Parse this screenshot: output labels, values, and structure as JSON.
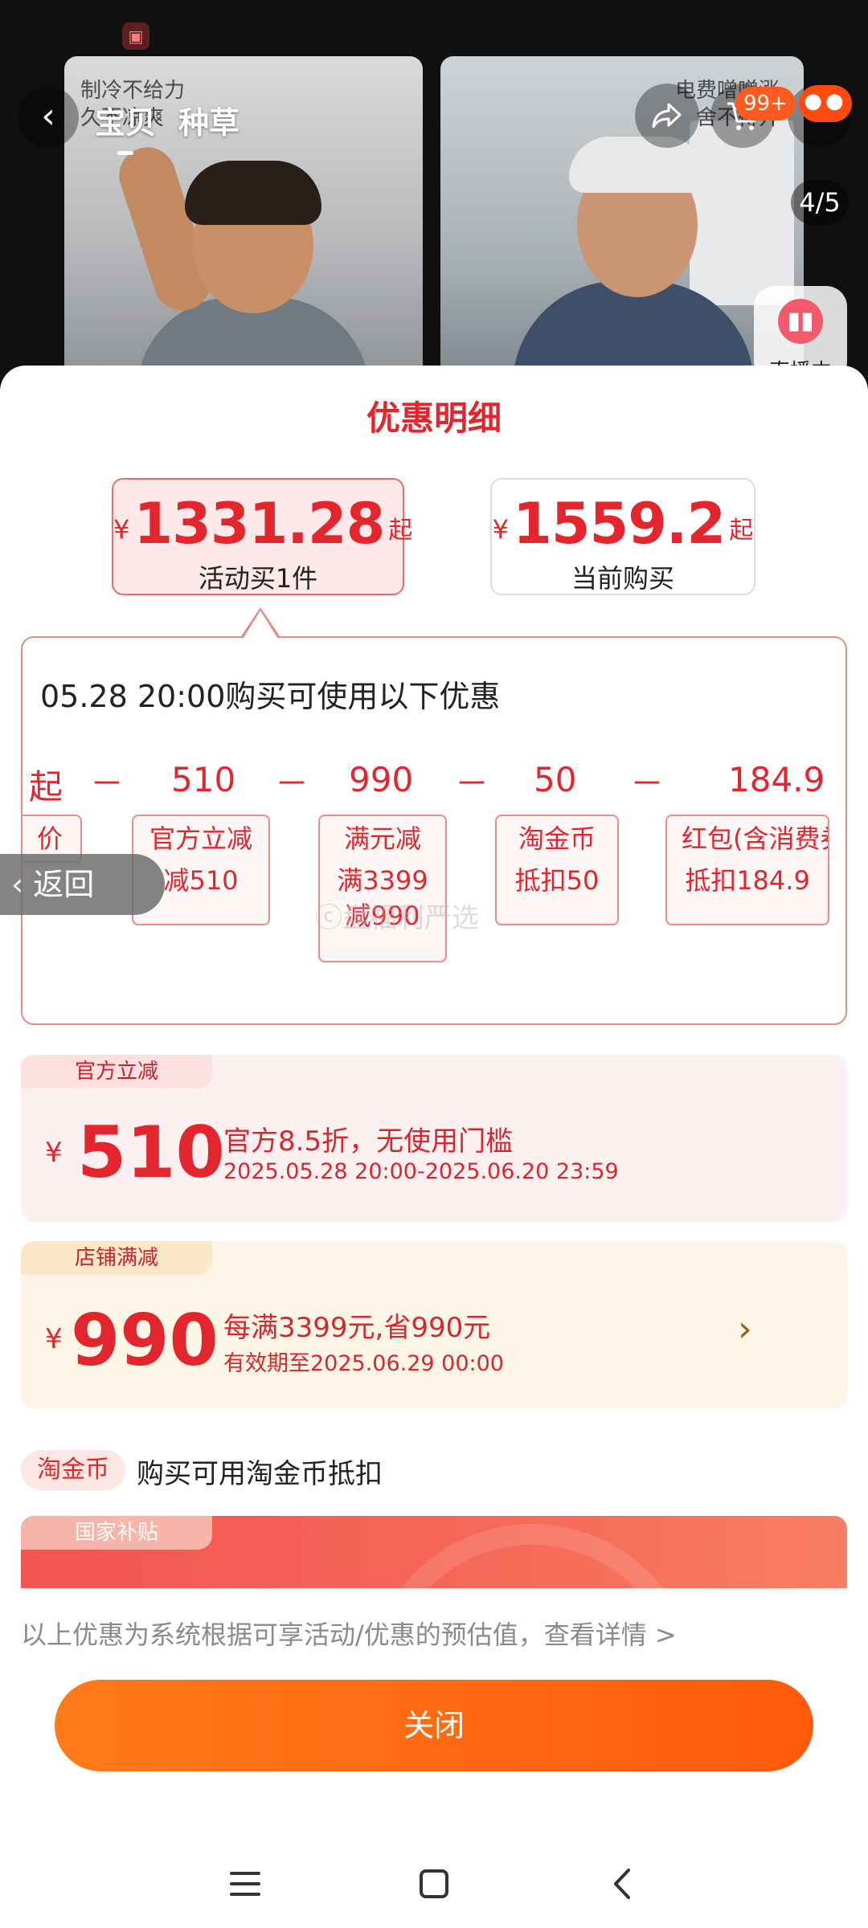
{
  "header": {
    "tabs": [
      "宝贝",
      "种草"
    ],
    "active_tab": 0,
    "cart_badge": "99+",
    "image_counter": "4/5",
    "live_label": "直播中"
  },
  "gallery": {
    "left_caption": "制冷不给力\n久不凉爽",
    "right_caption": "电费噌噌涨\n舍不得开"
  },
  "sheet": {
    "title": "优惠明细",
    "price_activity": {
      "currency": "¥",
      "amount": "1331.28",
      "suffix": "起",
      "label": "活动买1件"
    },
    "price_current": {
      "currency": "¥",
      "amount": "1559.2",
      "suffix": "起",
      "label": "当前购买"
    },
    "calc": {
      "heading": "05.28 20:00购买可使用以下优惠",
      "start_fragment": "起",
      "values": [
        "510",
        "990",
        "50",
        "184.9"
      ],
      "operators": [
        "－",
        "－",
        "－",
        "－"
      ],
      "chips": [
        {
          "title": "价",
          "detail": ""
        },
        {
          "title": "官方立减",
          "detail": "减510"
        },
        {
          "title": "满元减",
          "detail": "满3399\n减990"
        },
        {
          "title": "淘金币",
          "detail": "抵扣50"
        },
        {
          "title": "红包(含消费券)",
          "detail": "抵扣184.9"
        }
      ]
    },
    "back_label": "返回",
    "watermark": "ⓒ盘福利严选",
    "official": {
      "tag": "官方立减",
      "currency": "¥",
      "amount": "510",
      "main": "官方8.5折，无使用门槛",
      "sub": "2025.05.28 20:00-2025.06.20 23:59"
    },
    "store": {
      "tag": "店铺满减",
      "currency": "¥",
      "amount": "990",
      "main": "每满3399元,省990元",
      "sub": "有效期至2025.06.29 00:00"
    },
    "coin": {
      "tag": "淘金币",
      "text": "购买可用淘金币抵扣"
    },
    "gov": {
      "tag": "国家补贴"
    },
    "note": "以上优惠为系统根据可享活动/优惠的预估值，查看详情 >",
    "close_label": "关闭"
  },
  "colors": {
    "accent": "#e3262e",
    "button": "#ff6a10"
  }
}
